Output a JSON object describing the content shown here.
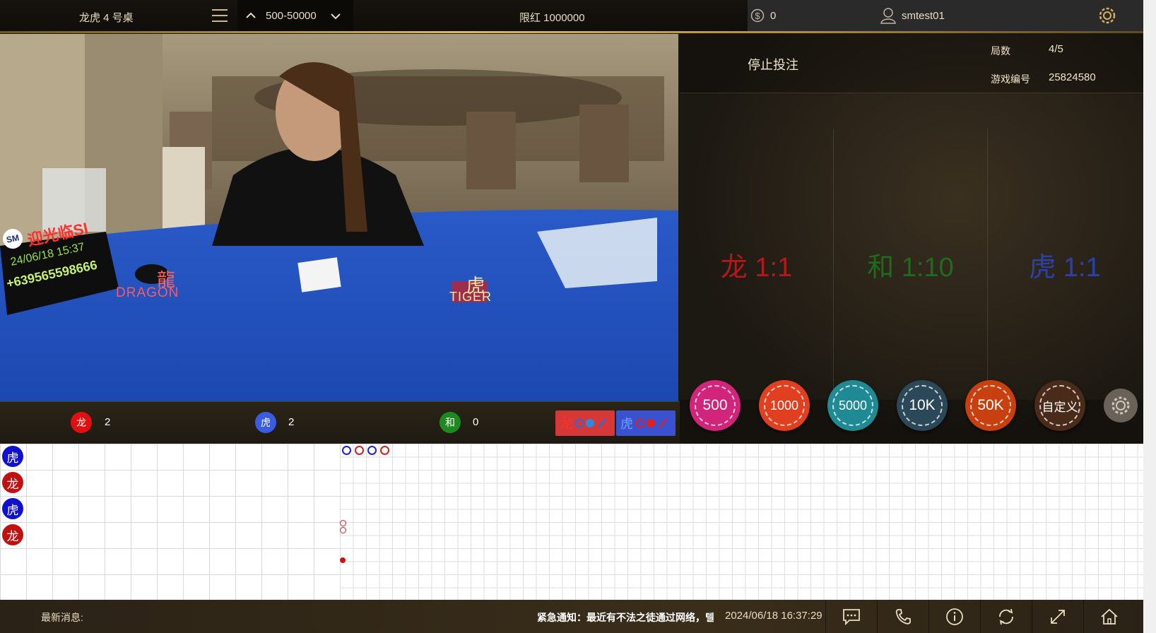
{
  "header": {
    "table_name": "龙虎 4 号桌",
    "limit_range": "500-50000",
    "max_limit": "限红 1000000",
    "balance": "0",
    "username": "smtest01"
  },
  "video": {
    "sign_line1": "迎光临SI",
    "sign_logo": "SM",
    "sign_date": "24/06/18 15:37",
    "sign_phone": "+639565598666",
    "table_dragon_cn": "龍",
    "table_dragon_en": "DRAGON",
    "table_tiger_cn": "虎",
    "table_tiger_en": "TIGER"
  },
  "round_info": {
    "status": "停止投注",
    "round_label": "局数",
    "round_value": "4/5",
    "game_id_label": "游戏编号",
    "game_id_value": "25824580"
  },
  "bet_options": [
    {
      "label": "龙 1:1",
      "color": "#b21a1a"
    },
    {
      "label": "和 1:10",
      "color": "#1f6b1c"
    },
    {
      "label": "虎 1:1",
      "color": "#2d40a8"
    }
  ],
  "stats": {
    "dragon": {
      "label": "龙",
      "count": "2",
      "color": "#e01010"
    },
    "tiger": {
      "label": "虎",
      "count": "2",
      "color": "#3a5ce0"
    },
    "tie": {
      "label": "和",
      "count": "0",
      "color": "#1e8a1e"
    },
    "ask_dragon": "龙",
    "ask_tiger": "虎"
  },
  "chips": [
    {
      "label": "500",
      "color": "#d0257a"
    },
    {
      "label": "1000",
      "color": "#e04020"
    },
    {
      "label": "5000",
      "color": "#1f8a94"
    },
    {
      "label": "10K",
      "color": "#2a4858"
    },
    {
      "label": "50K",
      "color": "#c84010"
    },
    {
      "label": "自定义",
      "color": "#4a2a18"
    }
  ],
  "bead_road": [
    {
      "label": "虎",
      "color": "#1010d0"
    },
    {
      "label": "龙",
      "color": "#c01010"
    },
    {
      "label": "虎",
      "color": "#1010d0"
    },
    {
      "label": "龙",
      "color": "#c01010"
    }
  ],
  "footer": {
    "news_label": "最新消息:",
    "ticker": "紧急通知：最近有不法之徒通过网络，텔",
    "datetime": "2024/06/18 16:37:29"
  },
  "icons": [
    "chat-icon",
    "phone-icon",
    "info-icon",
    "refresh-icon",
    "fullscreen-icon",
    "home-icon"
  ]
}
